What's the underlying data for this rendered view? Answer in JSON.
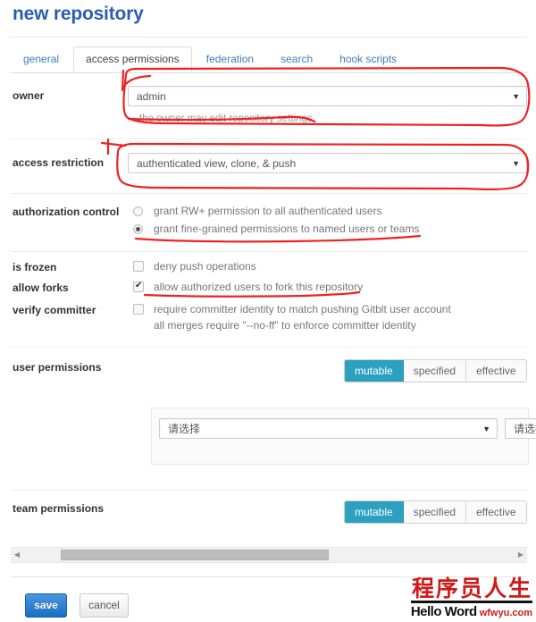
{
  "page": {
    "title": "new repository"
  },
  "tabs": [
    {
      "label": "general",
      "active": false
    },
    {
      "label": "access permissions",
      "active": true
    },
    {
      "label": "federation",
      "active": false
    },
    {
      "label": "search",
      "active": false
    },
    {
      "label": "hook scripts",
      "active": false
    }
  ],
  "fields": {
    "owner": {
      "label": "owner",
      "value": "admin",
      "hint": "the owner may edit repository settings",
      "caret": "▼"
    },
    "access_restriction": {
      "label": "access restriction",
      "value": "authenticated view, clone, & push",
      "caret": "▼"
    },
    "authorization_control": {
      "label": "authorization control",
      "options": [
        {
          "label": "grant RW+ permission to all authenticated users",
          "selected": false
        },
        {
          "label": "grant fine-grained permissions to named users or teams",
          "selected": true
        }
      ]
    },
    "is_frozen": {
      "label": "is frozen",
      "option": "deny push operations",
      "checked": false
    },
    "allow_forks": {
      "label": "allow forks",
      "option": "allow authorized users to fork this repository",
      "checked": true
    },
    "verify_committer": {
      "label": "verify committer",
      "option": "require committer identity to match pushing Gitblt user account",
      "option2": "all merges require \"--no-ff\" to enforce committer identity",
      "checked": false
    }
  },
  "user_permissions": {
    "label": "user permissions",
    "segments": [
      {
        "label": "mutable",
        "active": true
      },
      {
        "label": "specified",
        "active": false
      },
      {
        "label": "effective",
        "active": false
      }
    ],
    "select_value": "请选择",
    "select_value_secondary": "请选择",
    "caret": "▼"
  },
  "team_permissions": {
    "label": "team permissions",
    "segments": [
      {
        "label": "mutable",
        "active": true
      },
      {
        "label": "specified",
        "active": false
      },
      {
        "label": "effective",
        "active": false
      }
    ]
  },
  "scrollbar": {
    "left_arrow": "◀",
    "right_arrow": "▶"
  },
  "footer": {
    "save": "save",
    "cancel": "cancel"
  },
  "watermark": {
    "cn": "程序员人生",
    "en": "Hello Word",
    "site": "wfwyu.com"
  },
  "colors": {
    "title_blue": "#2a5db0",
    "tab_link": "#3b7cc0",
    "segment_active": "#2ba0c0",
    "save_blue": "#1a6fc4",
    "annotation_red": "#ee2222",
    "watermark_red": "#cf1a1a"
  }
}
